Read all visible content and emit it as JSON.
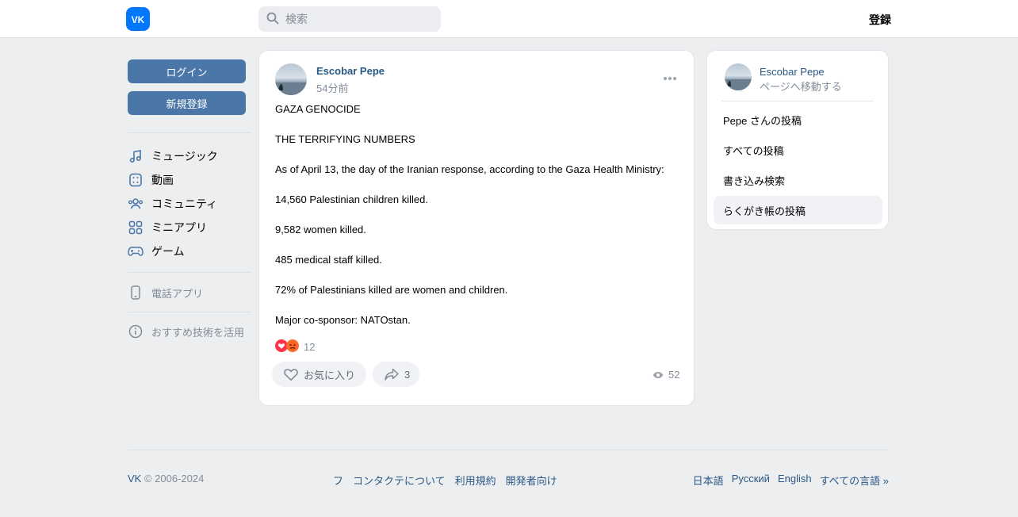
{
  "header": {
    "logo_text": "VK",
    "search_placeholder": "検索",
    "register_label": "登録"
  },
  "left": {
    "login_label": "ログイン",
    "signup_label": "新規登録",
    "nav": [
      {
        "label": "ミュージック",
        "icon": "music-icon"
      },
      {
        "label": "動画",
        "icon": "video-icon"
      },
      {
        "label": "コミュニティ",
        "icon": "community-icon"
      },
      {
        "label": "ミニアプリ",
        "icon": "mini-apps-icon"
      },
      {
        "label": "ゲーム",
        "icon": "gamepad-icon"
      }
    ],
    "phone_app_label": "電話アプリ",
    "recommend_label": "おすすめ技術を活用"
  },
  "post": {
    "author": "Escobar Pepe",
    "time": "54分前",
    "lines": [
      "GAZA GENOCIDE",
      "THE TERRIFYING NUMBERS",
      "As of April 13, the day of the Iranian response, according to the Gaza Health Ministry:",
      "14,560 Palestinian children killed.",
      "9,582 women killed.",
      "485 medical staff killed.",
      "72% of Palestinians killed are women and children.",
      "Major co-sponsor: NATOstan."
    ],
    "reactions_count": "12",
    "like_label": "お気に入り",
    "share_count": "3",
    "views_count": "52"
  },
  "side": {
    "name": "Escobar Pepe",
    "sub": "ページへ移動する",
    "items": [
      {
        "label": "Pepe さんの投稿"
      },
      {
        "label": "すべての投稿"
      },
      {
        "label": "書き込み検索"
      },
      {
        "label": "らくがき帳の投稿"
      }
    ]
  },
  "footer": {
    "brand": "VK",
    "copyright": " © 2006-2024",
    "links": [
      "フ",
      "コンタクテについて",
      "利用規約",
      "開発者向け"
    ],
    "langs": [
      "日本語",
      "Русский",
      "English",
      "すべての言語 »"
    ]
  }
}
